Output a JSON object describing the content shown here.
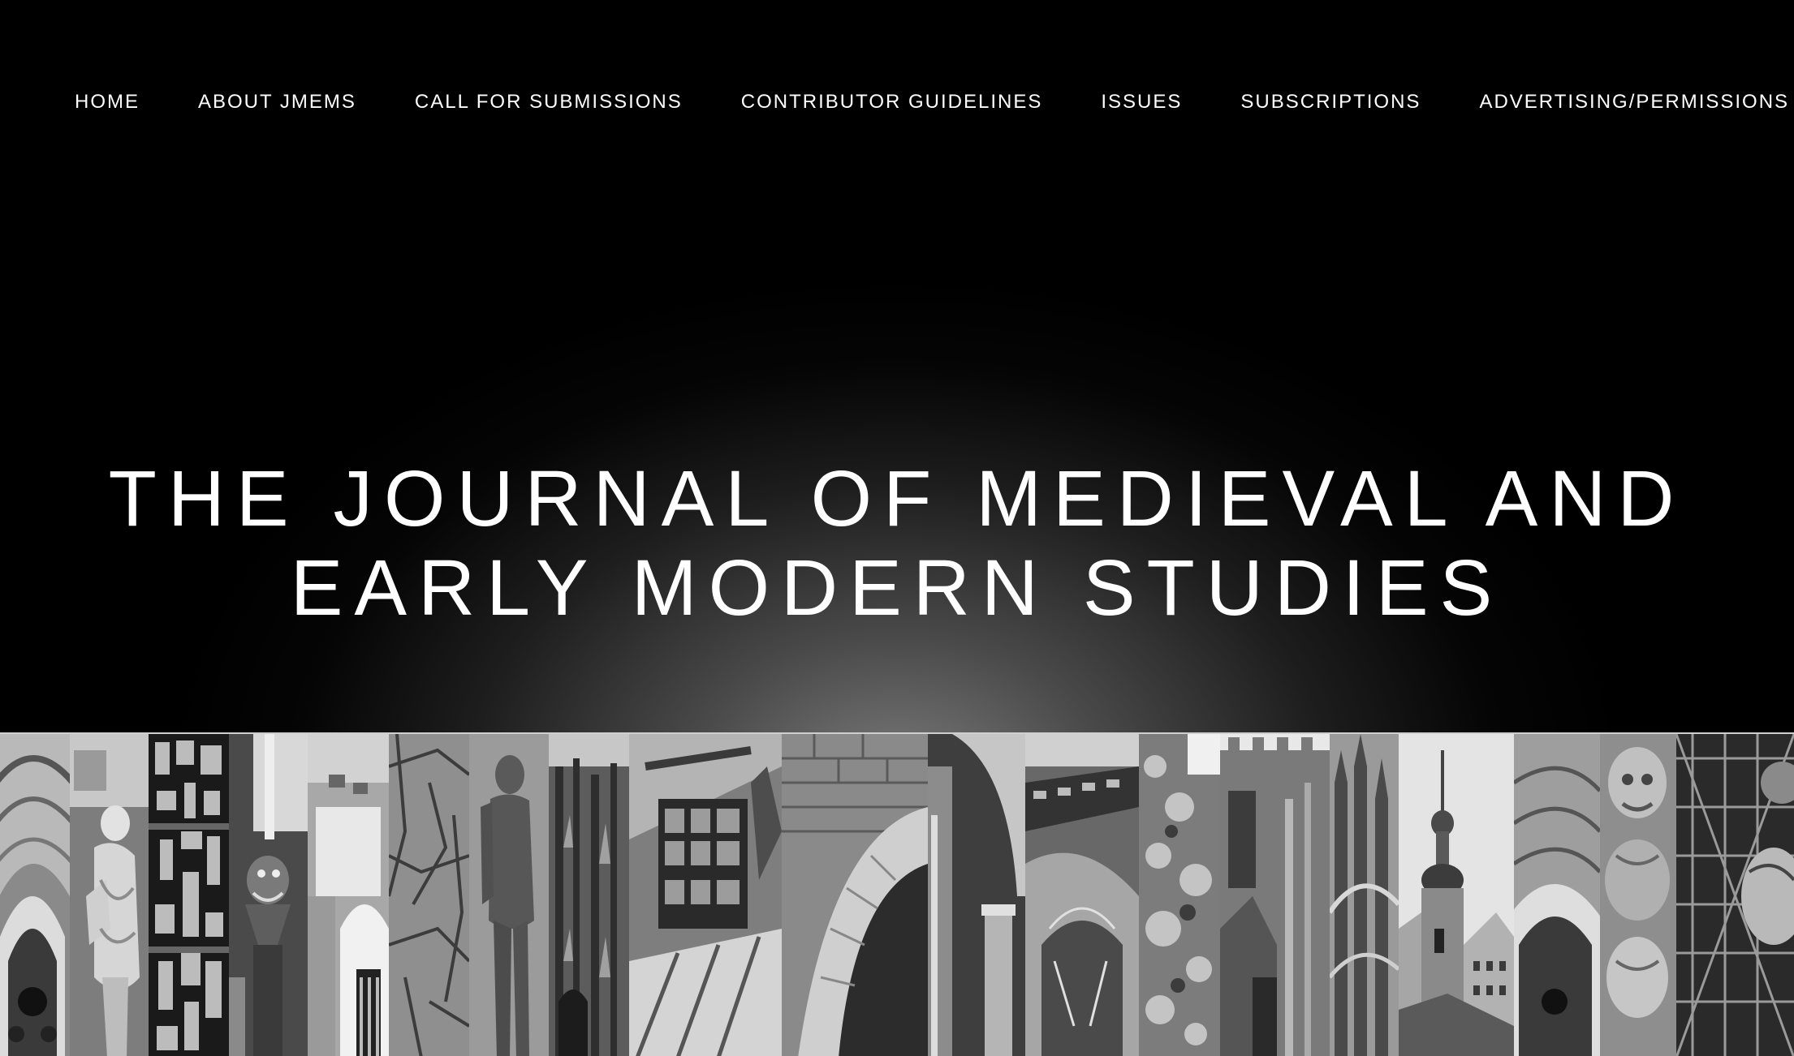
{
  "nav": {
    "items": [
      {
        "label": "HOME"
      },
      {
        "label": "ABOUT JMEMS"
      },
      {
        "label": "CALL FOR SUBMISSIONS"
      },
      {
        "label": "CONTRIBUTOR GUIDELINES"
      },
      {
        "label": "ISSUES"
      },
      {
        "label": "SUBSCRIPTIONS"
      },
      {
        "label": "ADVERTISING/PERMISSIONS"
      }
    ]
  },
  "hero": {
    "title_line1": "THE JOURNAL OF MEDIEVAL AND",
    "title_line2": "EARLY MODERN STUDIES"
  },
  "collage": {
    "image_names": [
      "gothic-arch-image",
      "female-statue-image",
      "stained-glass-image",
      "gargoyle-image",
      "building-facade-image",
      "stone-relief-image",
      "bronze-statue-image",
      "cathedral-spire-image",
      "timber-window-image",
      "stone-arch-image",
      "column-arch-image",
      "ornate-facade-image",
      "carved-relief-image",
      "tower-battlement-image",
      "gothic-pinnacle-image",
      "church-steeple-image",
      "arched-doorway-image",
      "carved-figure-image",
      "ornamental-metalwork-image"
    ]
  },
  "colors": {
    "background": "#000000",
    "text": "#ffffff",
    "glow": "#7a7a7a"
  }
}
